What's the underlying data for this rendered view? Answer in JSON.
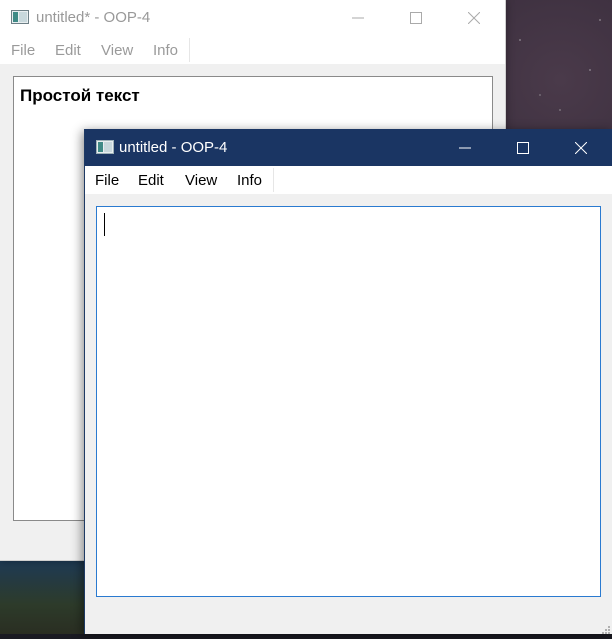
{
  "back_window": {
    "title": "untitled* - OOP-4",
    "menu": [
      "File",
      "Edit",
      "View",
      "Info"
    ],
    "text": "Простой текст",
    "active": false
  },
  "front_window": {
    "title": "untitled - OOP-4",
    "menu": [
      "File",
      "Edit",
      "View",
      "Info"
    ],
    "text": "",
    "active": true,
    "titlebar_color": "#1a3563",
    "focus_border_color": "#2a7ad0"
  },
  "icons": [
    "app-icon",
    "minimize-icon",
    "maximize-icon",
    "close-icon",
    "size-grip-icon"
  ]
}
